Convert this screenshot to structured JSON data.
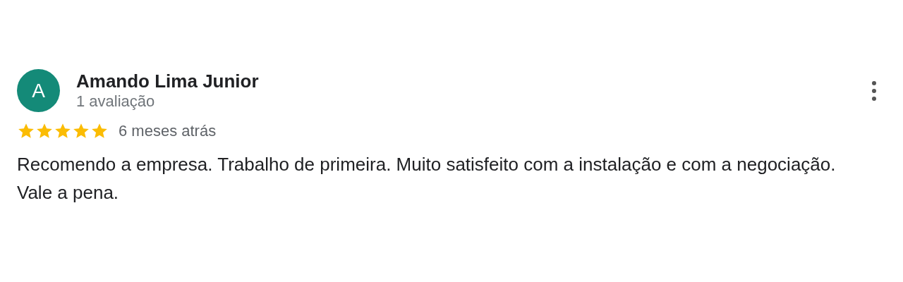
{
  "review": {
    "avatar_letter": "A",
    "author": "Amando Lima Junior",
    "review_count": "1 avaliação",
    "stars": 5,
    "time": "6 meses atrás",
    "text": "Recomendo a empresa. Trabalho de primeira. Muito satisfeito com a instalação e com a negociação. Vale a pena."
  }
}
